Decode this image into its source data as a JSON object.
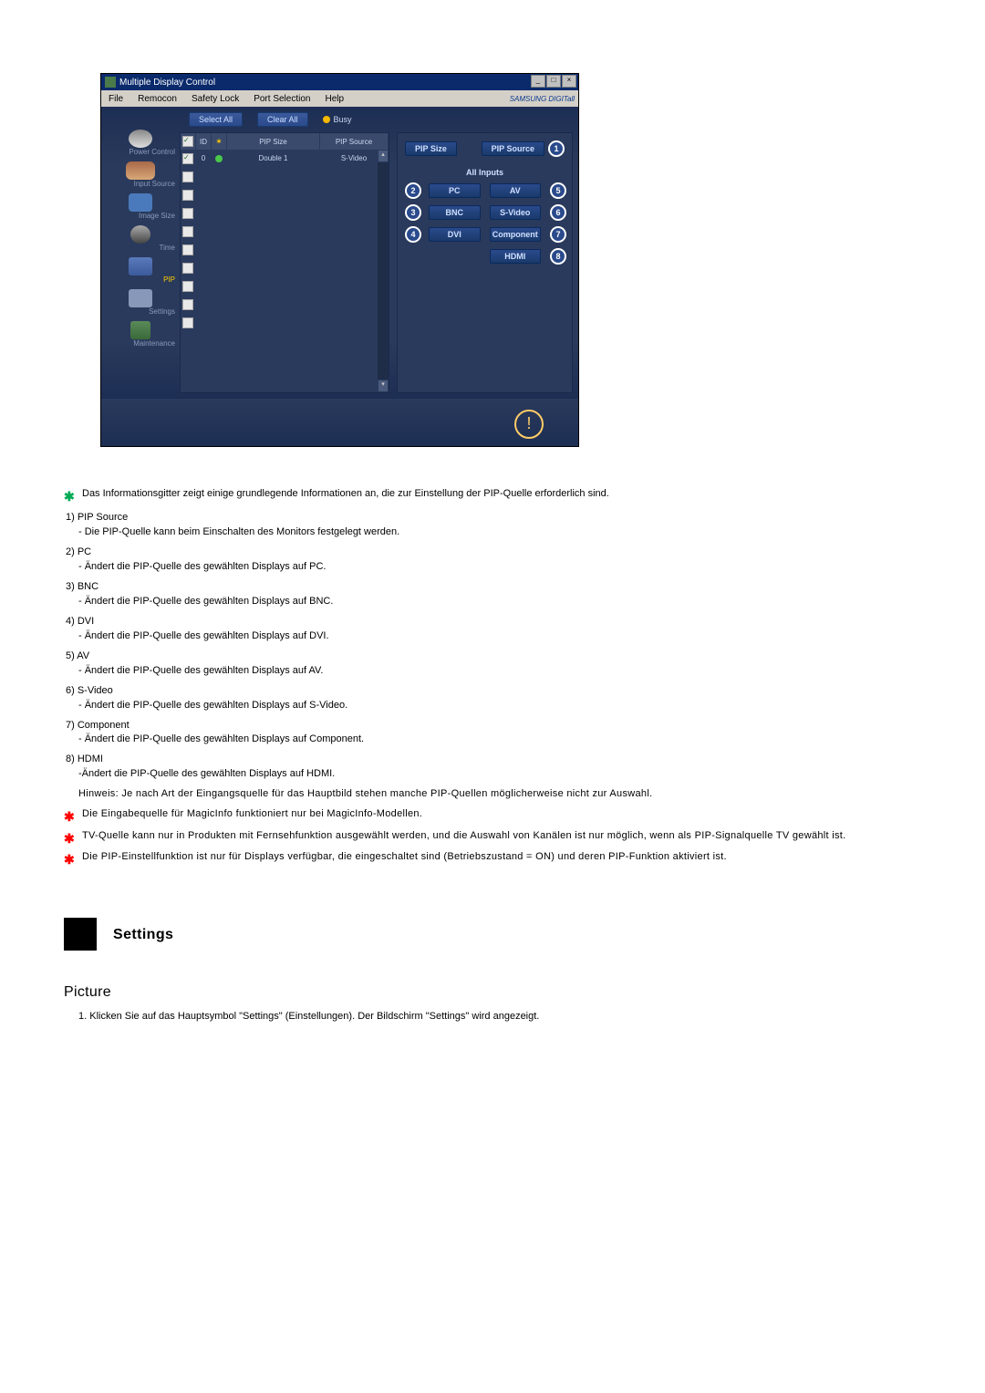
{
  "window": {
    "title": "Multiple Display Control",
    "menu": [
      "File",
      "Remocon",
      "Safety Lock",
      "Port Selection",
      "Help"
    ],
    "brand": "SAMSUNG DIGITall"
  },
  "toolbar": {
    "select_all": "Select All",
    "clear_all": "Clear All",
    "busy": "Busy"
  },
  "sidebar": {
    "items": [
      {
        "label": "Power Control"
      },
      {
        "label": "Input Source"
      },
      {
        "label": "Image Size"
      },
      {
        "label": "Time"
      },
      {
        "label": "PIP"
      },
      {
        "label": "Settings"
      },
      {
        "label": "Maintenance"
      }
    ]
  },
  "grid": {
    "headers": {
      "chk": "✓",
      "id": "ID",
      "st": "",
      "pip_size": "PIP Size",
      "pip_source": "PIP Source"
    },
    "row": {
      "id": "0",
      "pip_size": "Double 1",
      "pip_source": "S-Video"
    }
  },
  "right_panel": {
    "pip_size_btn": "PIP Size",
    "pip_source_btn": "PIP Source",
    "all_inputs": "All Inputs",
    "inputs_left": [
      {
        "n": "2",
        "label": "PC"
      },
      {
        "n": "3",
        "label": "BNC"
      },
      {
        "n": "4",
        "label": "DVI"
      }
    ],
    "inputs_right": [
      {
        "n": "5",
        "label": "AV"
      },
      {
        "n": "6",
        "label": "S-Video"
      },
      {
        "n": "7",
        "label": "Component"
      },
      {
        "n": "8",
        "label": "HDMI"
      }
    ],
    "top_badge": "1"
  },
  "doc": {
    "intro_note": "Das Informationsgitter zeigt einige grundlegende Informationen an, die zur Einstellung der PIP-Quelle erforderlich sind.",
    "items": [
      {
        "num": "1)",
        "name": "PIP Source",
        "desc": "- Die PIP-Quelle kann beim Einschalten des Monitors festgelegt werden."
      },
      {
        "num": "2)",
        "name": "PC",
        "desc": "- Ändert die PIP-Quelle des gewählten Displays auf PC."
      },
      {
        "num": "3)",
        "name": "BNC",
        "desc": "- Ändert die PIP-Quelle des gewählten Displays auf BNC."
      },
      {
        "num": "4)",
        "name": "DVI",
        "desc": "- Ändert die PIP-Quelle des gewählten Displays auf DVI."
      },
      {
        "num": "5)",
        "name": "AV",
        "desc": "- Ändert die PIP-Quelle des gewählten Displays auf AV."
      },
      {
        "num": "6)",
        "name": "S-Video",
        "desc": "- Ändert die PIP-Quelle des gewählten Displays auf S-Video."
      },
      {
        "num": "7)",
        "name": "Component",
        "desc": "- Ändert die PIP-Quelle des gewählten Displays auf Component."
      },
      {
        "num": "8)",
        "name": "HDMI",
        "desc": "-Ändert die PIP-Quelle des gewählten Displays auf HDMI."
      }
    ],
    "hinweis": "Hinweis: Je nach Art der Eingangsquelle für das Hauptbild stehen manche PIP-Quellen möglicherweise nicht zur Auswahl.",
    "star_notes": [
      "Die Eingabequelle für MagicInfo funktioniert nur bei MagicInfo-Modellen.",
      "TV-Quelle kann nur in Produkten mit Fernsehfunktion ausgewählt werden, und die Auswahl von Kanälen ist nur möglich, wenn als PIP-Signalquelle TV gewählt ist.",
      "Die PIP-Einstellfunktion ist nur für Displays verfügbar, die eingeschaltet sind (Betriebszustand = ON) und deren PIP-Funktion aktiviert ist."
    ],
    "settings_title": "Settings",
    "picture_title": "Picture",
    "picture_step": "1. Klicken Sie auf das Hauptsymbol \"Settings\" (Einstellungen). Der Bildschirm \"Settings\" wird angezeigt."
  }
}
